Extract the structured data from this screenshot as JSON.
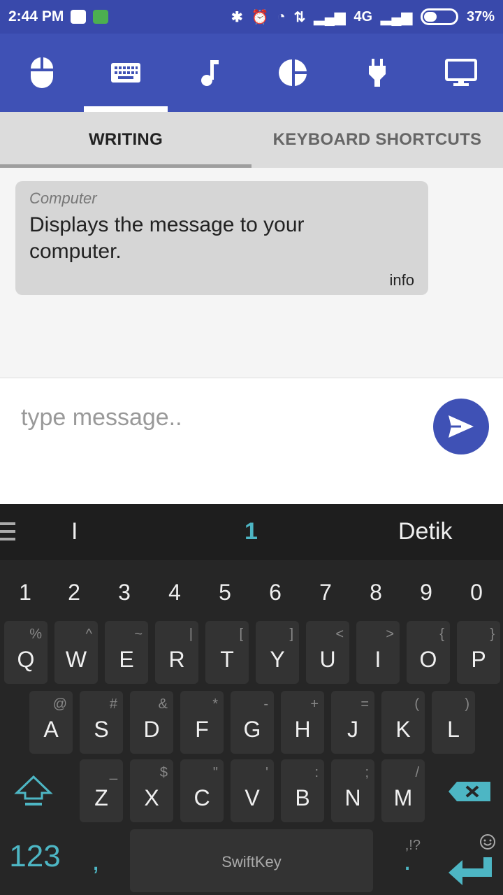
{
  "status_bar": {
    "time": "2:44 PM",
    "network": "4G",
    "battery": "37%"
  },
  "icon_tabs": [
    {
      "name": "mouse-icon",
      "active": false
    },
    {
      "name": "keyboard-icon",
      "active": true
    },
    {
      "name": "music-icon",
      "active": false
    },
    {
      "name": "pie-chart-icon",
      "active": false
    },
    {
      "name": "plug-icon",
      "active": false
    },
    {
      "name": "monitor-icon",
      "active": false
    }
  ],
  "tabs": {
    "writing": "WRITING",
    "shortcuts": "KEYBOARD SHORTCUTS"
  },
  "message": {
    "sender": "Computer",
    "text": "Displays the message to your computer.",
    "info": "info"
  },
  "input": {
    "placeholder": "type message.."
  },
  "keyboard": {
    "suggestions": [
      "I",
      "1",
      "Detik"
    ],
    "number_row": [
      "1",
      "2",
      "3",
      "4",
      "5",
      "6",
      "7",
      "8",
      "9",
      "0"
    ],
    "row1": [
      {
        "k": "Q",
        "a": "%"
      },
      {
        "k": "W",
        "a": "^"
      },
      {
        "k": "E",
        "a": "~"
      },
      {
        "k": "R",
        "a": "|"
      },
      {
        "k": "T",
        "a": "["
      },
      {
        "k": "Y",
        "a": "]"
      },
      {
        "k": "U",
        "a": "<"
      },
      {
        "k": "I",
        "a": ">"
      },
      {
        "k": "O",
        "a": "{"
      },
      {
        "k": "P",
        "a": "}"
      }
    ],
    "row2": [
      {
        "k": "A",
        "a": "@"
      },
      {
        "k": "S",
        "a": "#"
      },
      {
        "k": "D",
        "a": "&"
      },
      {
        "k": "F",
        "a": "*"
      },
      {
        "k": "G",
        "a": "-"
      },
      {
        "k": "H",
        "a": "+"
      },
      {
        "k": "J",
        "a": "="
      },
      {
        "k": "K",
        "a": "("
      },
      {
        "k": "L",
        "a": ")"
      }
    ],
    "row3": [
      {
        "k": "Z",
        "a": "_"
      },
      {
        "k": "X",
        "a": "$"
      },
      {
        "k": "C",
        "a": "\""
      },
      {
        "k": "V",
        "a": "'"
      },
      {
        "k": "B",
        "a": ":"
      },
      {
        "k": "N",
        "a": ";"
      },
      {
        "k": "M",
        "a": "/"
      }
    ],
    "symbols_label": "123",
    "comma": ",",
    "space_brand": "SwiftKey",
    "period": ".",
    "period_alt": ",!?"
  }
}
